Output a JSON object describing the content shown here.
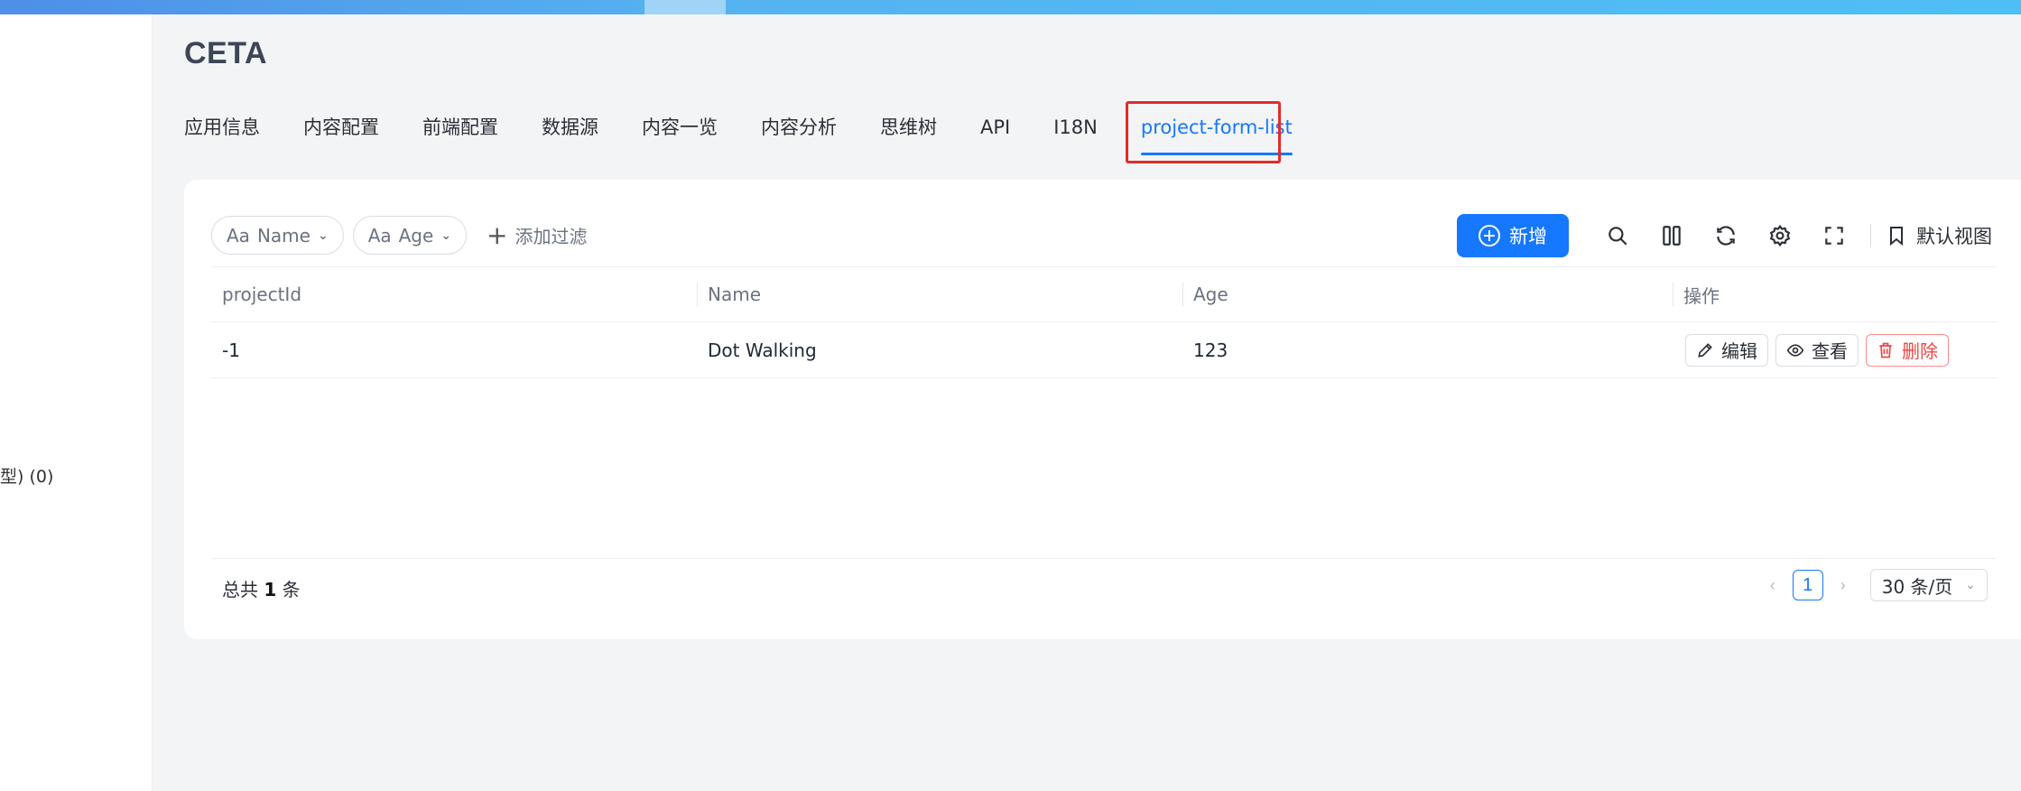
{
  "app": {
    "title": "CETA"
  },
  "sidebar": {
    "fragment": "型) (0)"
  },
  "tabs": [
    {
      "label": "应用信息"
    },
    {
      "label": "内容配置"
    },
    {
      "label": "前端配置"
    },
    {
      "label": "数据源"
    },
    {
      "label": "内容一览"
    },
    {
      "label": "内容分析"
    },
    {
      "label": "思维树"
    },
    {
      "label": "API"
    },
    {
      "label": "I18N"
    },
    {
      "label": "project-form-list",
      "active": true
    }
  ],
  "filters": {
    "chips": [
      {
        "prefix": "Aa",
        "label": "Name"
      },
      {
        "prefix": "Aa",
        "label": "Age"
      }
    ],
    "add_filter": "添加过滤"
  },
  "toolbar": {
    "new_label": "新增",
    "saved_view_label": "默认视图",
    "icons": [
      "search-icon",
      "columns-icon",
      "refresh-icon",
      "settings-icon",
      "fullscreen-icon",
      "bookmark-icon"
    ]
  },
  "table": {
    "columns": [
      "projectId",
      "Name",
      "Age",
      "操作"
    ],
    "rows": [
      {
        "projectId": "-1",
        "name": "Dot Walking",
        "age": "123"
      }
    ],
    "actions": {
      "edit": "编辑",
      "view": "查看",
      "delete": "删除"
    }
  },
  "footer": {
    "total_prefix": "总共",
    "total_count": "1",
    "total_suffix": "条",
    "current_page": "1",
    "page_size": "30 条/页"
  },
  "colors": {
    "primary": "#1677ff",
    "danger": "#ef4444",
    "highlight": "#e42a2a"
  }
}
